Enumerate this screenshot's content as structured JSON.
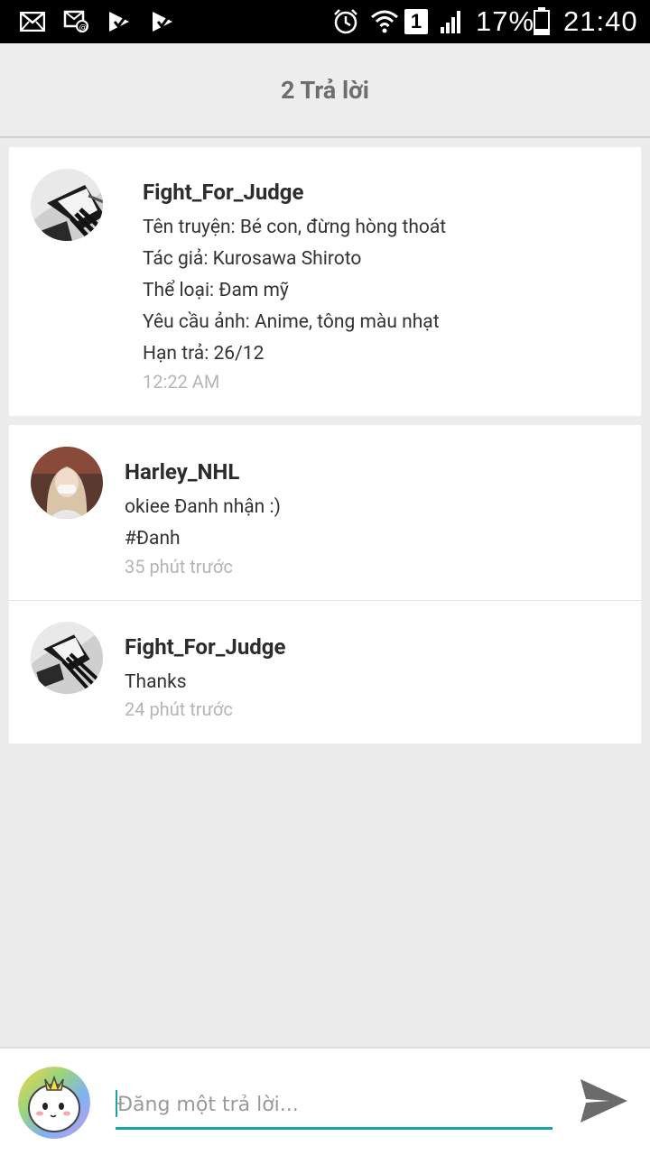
{
  "status_bar": {
    "battery": "17%",
    "time": "21:40",
    "sim_slot": "1",
    "icons": [
      "mail-icon",
      "email-notification-icon",
      "play-store-icon",
      "play-store-icon",
      "alarm-icon",
      "wifi-icon",
      "sim-icon",
      "signal-icon",
      "battery-icon"
    ]
  },
  "header": {
    "title": "2 Trả lời"
  },
  "original_post": {
    "username": "Fight_For_Judge",
    "lines": [
      "Tên truyện: Bé con, đừng hòng thoát",
      "Tác giả: Kurosawa Shiroto",
      "Thể loại: Đam mỹ",
      "Yêu cầu ảnh: Anime, tông màu nhạt",
      "Hạn trả: 26/12"
    ],
    "time": "12:22 AM"
  },
  "replies": [
    {
      "username": "Harley_NHL",
      "lines": [
        "okiee Đanh nhận :)",
        "#Đanh"
      ],
      "time": "35 phút trước"
    },
    {
      "username": "Fight_For_Judge",
      "lines": [
        "Thanks"
      ],
      "time": "24 phút trước"
    }
  ],
  "composer": {
    "placeholder": "Đăng một trả lời...",
    "value": "",
    "send_icon": "send-icon"
  },
  "colors": {
    "accent": "#19a5a8",
    "header_bg": "#ededed",
    "page_bg": "#ececec",
    "timestamp": "#b5b5b5",
    "send_icon": "#6b6b6b"
  }
}
